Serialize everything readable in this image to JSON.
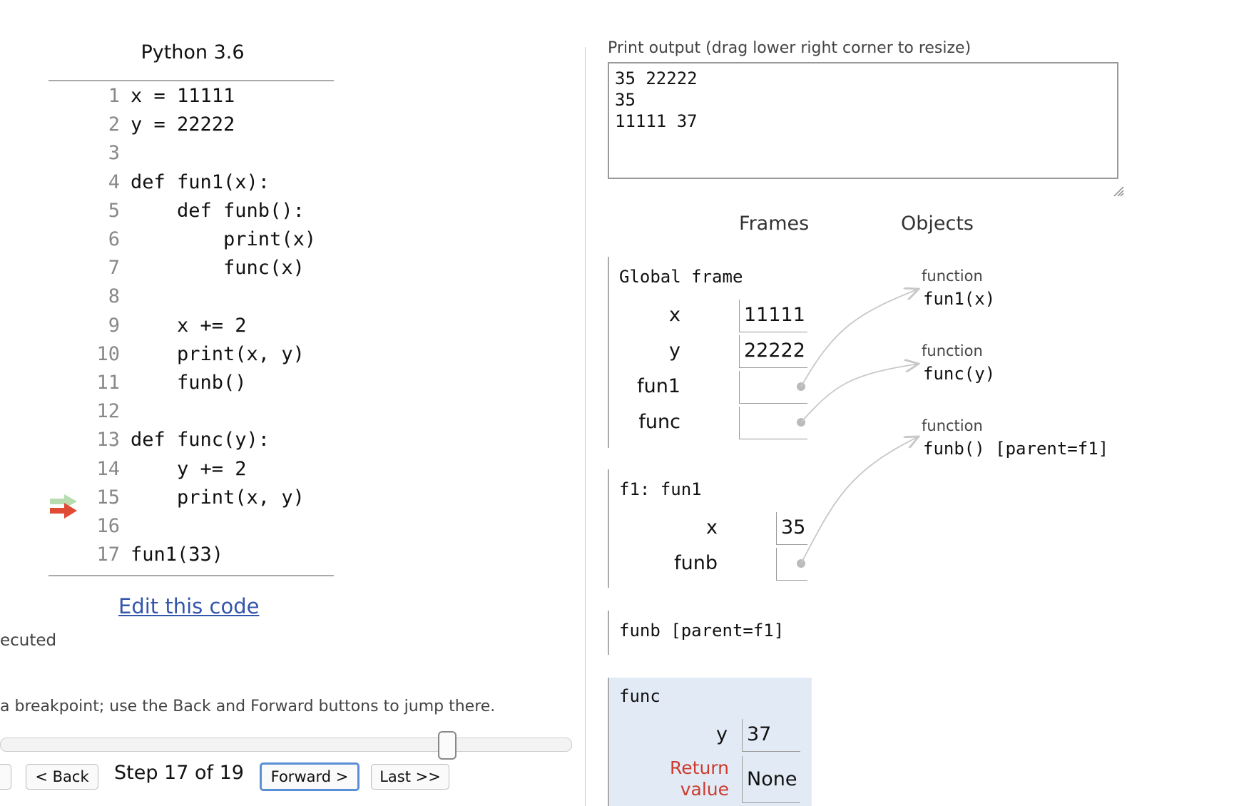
{
  "left_panel": {
    "language": "Python 3.6",
    "code_lines": [
      {
        "num": "1",
        "text": "x = 11111"
      },
      {
        "num": "2",
        "text": "y = 22222"
      },
      {
        "num": "3",
        "text": ""
      },
      {
        "num": "4",
        "text": "def fun1(x):"
      },
      {
        "num": "5",
        "text": "    def funb():"
      },
      {
        "num": "6",
        "text": "        print(x)"
      },
      {
        "num": "7",
        "text": "        func(x)"
      },
      {
        "num": "8",
        "text": ""
      },
      {
        "num": "9",
        "text": "    x += 2"
      },
      {
        "num": "10",
        "text": "    print(x, y)"
      },
      {
        "num": "11",
        "text": "    funb()"
      },
      {
        "num": "12",
        "text": ""
      },
      {
        "num": "13",
        "text": "def func(y):"
      },
      {
        "num": "14",
        "text": "    y += 2"
      },
      {
        "num": "15",
        "text": "    print(x, y)"
      },
      {
        "num": "16",
        "text": ""
      },
      {
        "num": "17",
        "text": "fun1(33)"
      }
    ],
    "edit_link": "Edit this code",
    "executed_fragment": "ecuted",
    "breakpoint_hint": "a breakpoint; use the Back and Forward buttons to jump there.",
    "controls": {
      "back": "< Back",
      "step": "Step 17 of 19",
      "forward": "Forward >",
      "last": "Last >>"
    },
    "arrow_colors": {
      "previous": "#b6dcb0",
      "current": "#e04b35"
    }
  },
  "right_panel": {
    "print_label": "Print output (drag lower right corner to resize)",
    "print_output": [
      "35 22222",
      "35",
      "11111 37"
    ],
    "frames_header": "Frames",
    "objects_header": "Objects",
    "global_frame": {
      "title": "Global frame",
      "vars": [
        {
          "name": "x",
          "value": "11111"
        },
        {
          "name": "y",
          "value": "22222"
        },
        {
          "name": "fun1",
          "value": ""
        },
        {
          "name": "func",
          "value": ""
        }
      ]
    },
    "f1_frame": {
      "title": "f1: fun1",
      "vars": [
        {
          "name": "x",
          "value": "35"
        },
        {
          "name": "funb",
          "value": ""
        }
      ]
    },
    "funb_frame": {
      "title": "funb [parent=f1]"
    },
    "func_frame": {
      "title": "func",
      "vars": [
        {
          "name": "y",
          "value": "37"
        }
      ],
      "return_label_1": "Return",
      "return_label_2": "value",
      "return_value": "None",
      "highlight_color": "#e2ebf5"
    },
    "objects": [
      {
        "type": "function",
        "name": "fun1(x)"
      },
      {
        "type": "function",
        "name": "func(y)"
      },
      {
        "type": "function",
        "name": "funb() [parent=f1]"
      }
    ]
  }
}
